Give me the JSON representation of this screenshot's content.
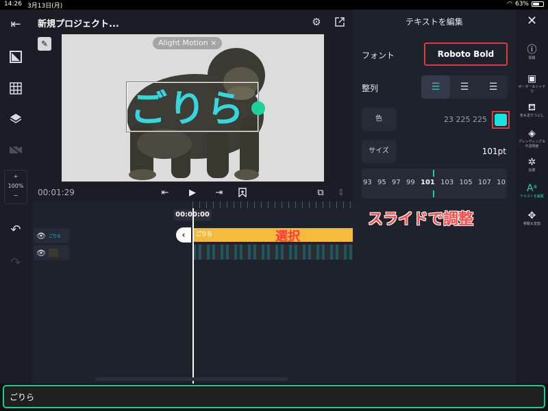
{
  "status": {
    "time": "14:26",
    "date": "3月13日(月)",
    "battery": "63%",
    "battery_level": 0.63
  },
  "project": {
    "title": "新規プロジェクト..."
  },
  "preview": {
    "watermark": "Alight Motion ×",
    "overlay_text": "ごりら"
  },
  "transport": {
    "timecode": "00:01:29",
    "playhead_time": "00:00:00"
  },
  "left_toolbar": {
    "zoom_plus": "+",
    "zoom_value": "100%",
    "zoom_minus": "−"
  },
  "timeline": {
    "text_layer_label": "ごりら",
    "text_clip_label": "ごりら",
    "annotation_select": "選択"
  },
  "panel": {
    "title": "テキストを編集",
    "font_label": "フォント",
    "font_value": "Roboto Bold",
    "align_label": "整列",
    "color_label": "色",
    "color_rgb": "23 225 225",
    "color_hex": "#17e1e1",
    "size_label": "サイズ",
    "size_value": "101pt",
    "slider_values": [
      "93",
      "95",
      "97",
      "99",
      "101",
      "103",
      "105",
      "107",
      "10"
    ],
    "slider_selected": "101",
    "annotation_slide": "スライドで調整"
  },
  "right_tools": [
    {
      "label": "情報",
      "icon": "info-icon"
    },
    {
      "label": "ボーダー＆シャドウ",
      "icon": "border-shadow-icon"
    },
    {
      "label": "色＆塗りつぶし",
      "icon": "paint-bucket-icon"
    },
    {
      "label": "ブレンディング＆不透明度",
      "icon": "blending-icon"
    },
    {
      "label": "効果",
      "icon": "effects-icon"
    },
    {
      "label": "テキストを編集",
      "icon": "text-edit-icon",
      "active": true
    },
    {
      "label": "移動＆変換",
      "icon": "move-transform-icon"
    }
  ],
  "bottom": {
    "input_value": "ごりら"
  },
  "colors": {
    "accent": "#29d3a6",
    "annotation_red": "#ff3b3b",
    "text_cyan": "#33d7dd",
    "clip_orange": "#f5b93c"
  }
}
